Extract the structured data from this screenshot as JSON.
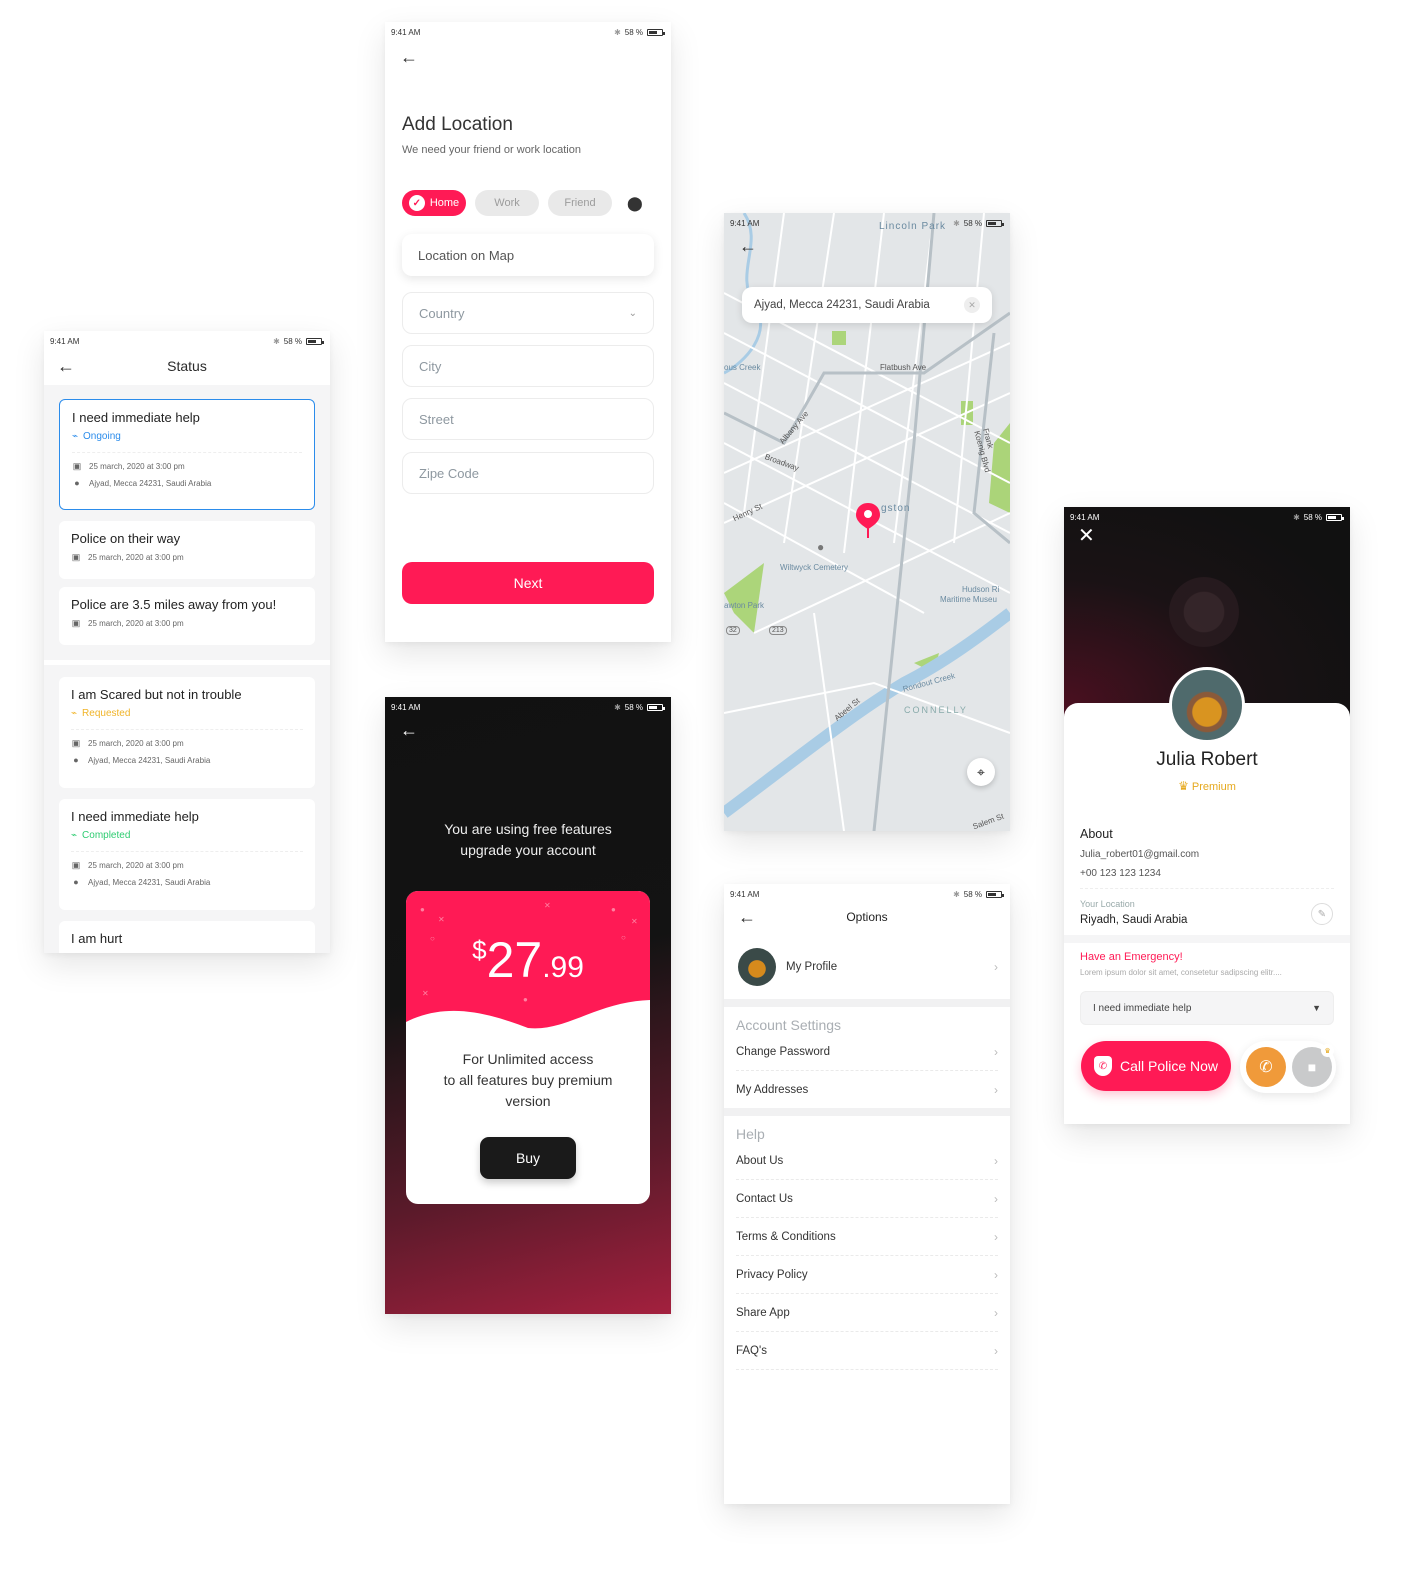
{
  "statusbar": {
    "time": "9:41 AM",
    "battery": "58 %",
    "bluetooth_icon": "bluetooth-icon"
  },
  "status_screen": {
    "title": "Status",
    "cards": [
      {
        "title": "I need immediate help",
        "status": "Ongoing",
        "status_color": "#2b8ceb",
        "date": "25 march, 2020 at 3:00 pm",
        "location": "Ajyad, Mecca 24231, Saudi Arabia",
        "active": true
      },
      {
        "title": "Police on their way",
        "date": "25 march, 2020 at 3:00 pm"
      },
      {
        "title": "Police are 3.5 miles away from you!",
        "date": "25 march, 2020 at 3:00 pm"
      },
      {
        "title": "I am Scared but not in trouble",
        "status": "Requested",
        "status_color": "#f0b429",
        "date": "25 march, 2020 at 3:00 pm",
        "location": "Ajyad, Mecca 24231, Saudi Arabia"
      },
      {
        "title": "I need immediate help",
        "status": "Completed",
        "status_color": "#2ecc71",
        "date": "25 march, 2020 at 3:00 pm",
        "location": "Ajyad, Mecca 24231, Saudi Arabia"
      },
      {
        "title": "I am hurt"
      }
    ]
  },
  "add_location": {
    "title": "Add Location",
    "subtitle": "We need your friend or work location",
    "chips": [
      {
        "label": "Home",
        "selected": true
      },
      {
        "label": "Work",
        "selected": false
      },
      {
        "label": "Friend",
        "selected": false
      }
    ],
    "fields": {
      "location_on_map": "Location on Map",
      "country": "Country",
      "city": "City",
      "street": "Street",
      "zip": "Zipe Code"
    },
    "next_label": "Next"
  },
  "premium": {
    "headline_1": "You are using free features",
    "headline_2": "upgrade your account",
    "currency": "$",
    "price_whole": "27",
    "price_cents": ".99",
    "desc_1": "For Unlimited access",
    "desc_2": "to all features buy premium",
    "desc_3": "version",
    "buy_label": "Buy"
  },
  "map": {
    "search_value": "Ajyad, Mecca 24231, Saudi Arabia",
    "labels": {
      "lincoln_park": "Lincoln Park",
      "flatbush": "Flatbush Ave",
      "albany": "Albany Ave",
      "broadway": "Broadway",
      "henry": "Henry St",
      "kingston": "gston",
      "cemetery": "Wiltwyck Cemetery",
      "hudson": "Hudson Ri",
      "maritime": "Maritime Museu",
      "frank_koenig": "Frank Koenig Blvd",
      "rondout": "Rondout Creek",
      "connelly": "CONNELLY",
      "abeel": "Abeel St",
      "lawton": "awton Park",
      "creek": "ous Creek",
      "route_213": "213",
      "route_32": "32",
      "salem": "Salem St"
    },
    "accent": "#ff1a55"
  },
  "options": {
    "title": "Options",
    "profile_label": "My Profile",
    "account_section": "Account Settings",
    "account_items": [
      "Change Password",
      "My Addresses"
    ],
    "help_section": "Help",
    "help_items": [
      "About Us",
      "Contact Us",
      "Terms & Conditions",
      "Privacy Policy",
      "Share App",
      "FAQ's"
    ]
  },
  "profile": {
    "name": "Julia Robert",
    "tier": "Premium",
    "about_label": "About",
    "email": "Julia_robert01@gmail.com",
    "phone": "+00 123 123 1234",
    "location_label": "Your Location",
    "location": "Riyadh, Saudi Arabia",
    "emergency_title": "Have an Emergency!",
    "emergency_sub": "Lorem ipsum dolor sit amet, consetetur sadipscing elitr....",
    "emergency_select": "I need immediate help",
    "call_label": "Call Police Now"
  },
  "colors": {
    "brand": "#ff1a55",
    "ongoing": "#2b8ceb",
    "requested": "#f0b429",
    "completed": "#2ecc71",
    "premium": "#e6a91e"
  }
}
